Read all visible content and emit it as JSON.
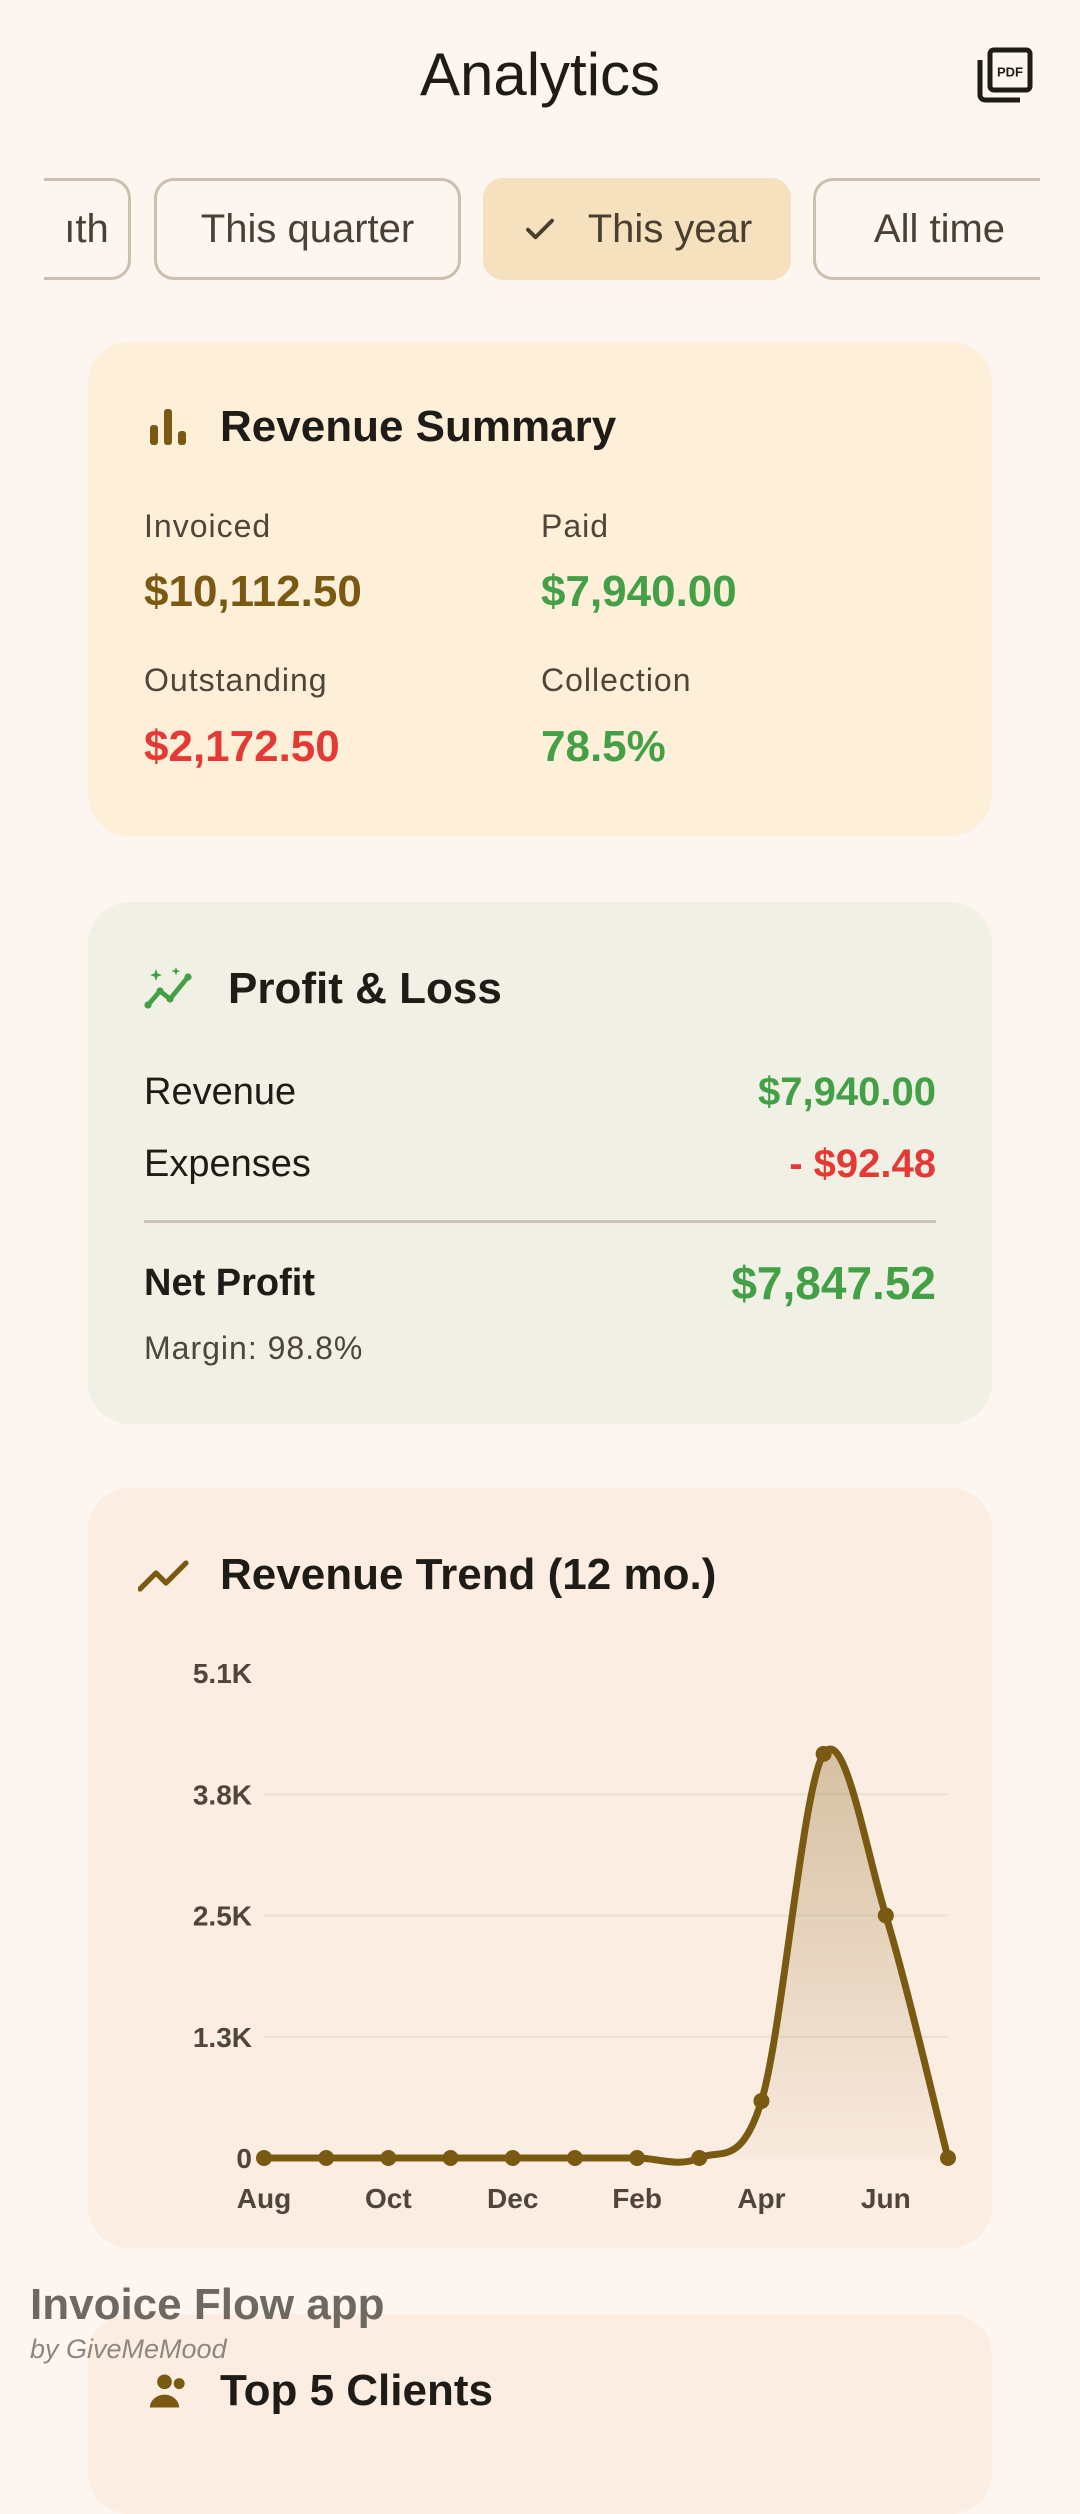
{
  "header": {
    "title": "Analytics",
    "pdf_icon": "pdf-export-icon"
  },
  "filters": [
    {
      "label": "This month",
      "visible_label": "ıth",
      "selected": false
    },
    {
      "label": "This quarter",
      "visible_label": "This quarter",
      "selected": false
    },
    {
      "label": "This year",
      "visible_label": "This year",
      "selected": true
    },
    {
      "label": "All time",
      "visible_label": "All time",
      "selected": false
    }
  ],
  "revenue_summary": {
    "title": "Revenue Summary",
    "icon": "bar-chart-icon",
    "invoiced_label": "Invoiced",
    "invoiced_value": "$10,112.50",
    "paid_label": "Paid",
    "paid_value": "$7,940.00",
    "outstanding_label": "Outstanding",
    "outstanding_value": "$2,172.50",
    "collection_label": "Collection",
    "collection_value": "78.5%"
  },
  "profit_loss": {
    "title": "Profit & Loss",
    "icon": "sparkle-trend-icon",
    "revenue_label": "Revenue",
    "revenue_value": "$7,940.00",
    "expenses_label": "Expenses",
    "expenses_value": "- $92.48",
    "net_label": "Net Profit",
    "net_value": "$7,847.52",
    "margin_text": "Margin: 98.8%"
  },
  "revenue_trend": {
    "title": "Revenue Trend (12 mo.)",
    "icon": "trend-line-icon"
  },
  "chart_data": {
    "type": "area",
    "title": "Revenue Trend (12 mo.)",
    "x": [
      "Aug",
      "Sep",
      "Oct",
      "Nov",
      "Dec",
      "Jan",
      "Feb",
      "Mar",
      "Apr",
      "May",
      "Jun",
      "Jul"
    ],
    "x_tick_labels": [
      "Aug",
      "Oct",
      "Dec",
      "Feb",
      "Apr",
      "Jun"
    ],
    "values": [
      0,
      0,
      0,
      0,
      0,
      0,
      0,
      0,
      600,
      4250,
      2550,
      0
    ],
    "y_ticks": [
      "0",
      "1.3K",
      "2.5K",
      "3.8K",
      "5.1K"
    ],
    "y_tick_values": [
      0,
      1275,
      2550,
      3825,
      5100
    ],
    "ylim": [
      0,
      5100
    ],
    "grid": true,
    "line_color": "#7a5a12"
  },
  "next_section": {
    "title": "Top 5 Clients"
  },
  "watermark": {
    "title": "Invoice Flow app",
    "subtitle": "by GiveMeMood"
  },
  "colors": {
    "gold": "#7a5a12",
    "green": "#43a047",
    "red": "#e53935"
  }
}
